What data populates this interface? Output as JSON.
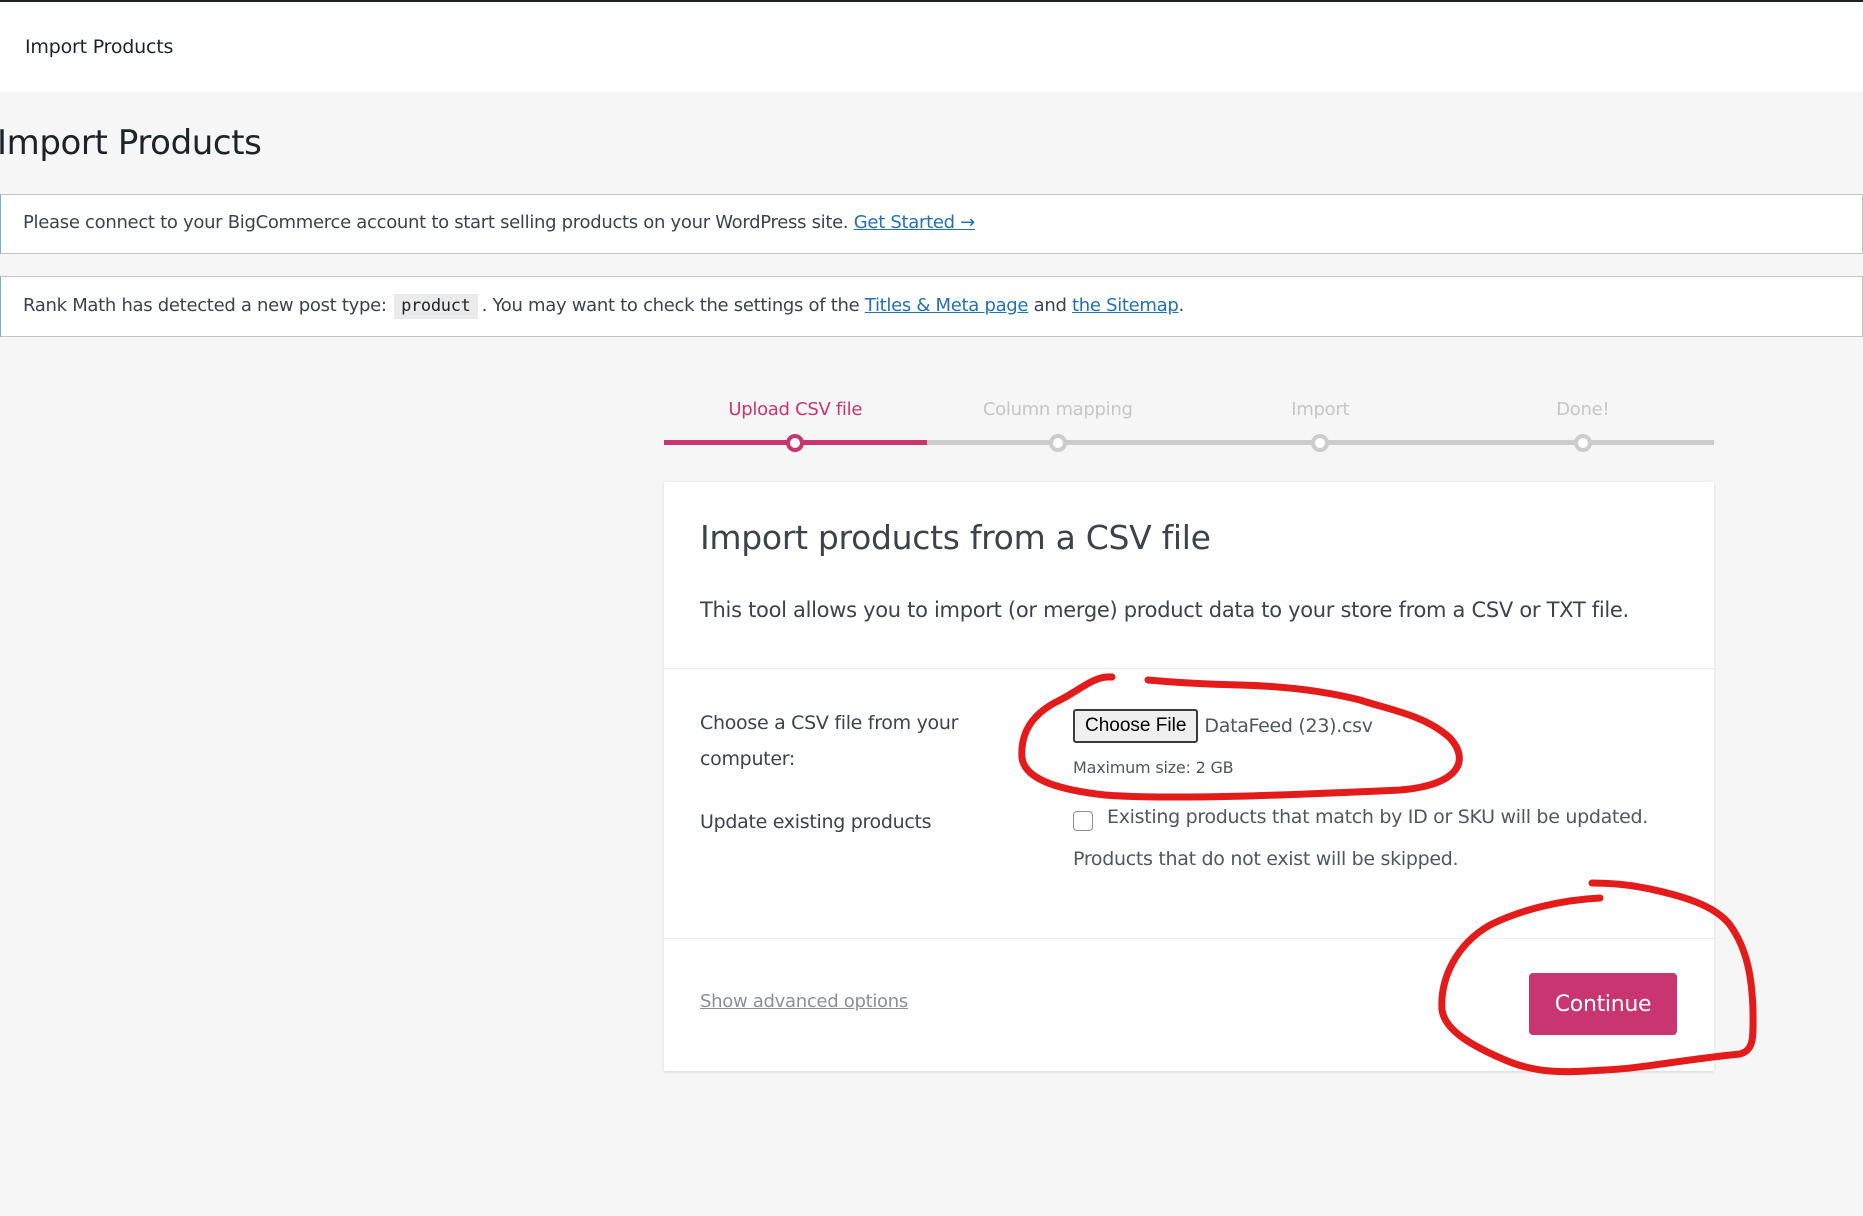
{
  "header": {
    "title": "Import Products"
  },
  "page": {
    "title": "Import Products"
  },
  "notices": [
    {
      "text": "Please connect to your BigCommerce account to start selling products on your WordPress site.",
      "link": "Get Started →"
    },
    {
      "text_before": "Rank Math has detected a new post type:",
      "code": "product",
      "text_middle": ". You may want to check the settings of the",
      "link1": "Titles & Meta page",
      "text_and": "and",
      "link2": "the Sitemap",
      "text_end": "."
    }
  ],
  "stepper": {
    "steps": [
      {
        "label": "Upload CSV file",
        "active": true
      },
      {
        "label": "Column mapping",
        "active": false
      },
      {
        "label": "Import",
        "active": false
      },
      {
        "label": "Done!",
        "active": false
      }
    ]
  },
  "card": {
    "title": "Import products from a CSV file",
    "description": "This tool allows you to import (or merge) product data to your store from a CSV or TXT file.",
    "file_row": {
      "label": "Choose a CSV file from your computer:",
      "button": "Choose File",
      "file_name": "DataFeed (23).csv",
      "max_size": "Maximum size: 2 GB"
    },
    "update_row": {
      "label": "Update existing products",
      "checked": false,
      "checkbox_text": "Existing products that match by ID or SKU will be updated.",
      "note": "Products that do not exist will be skipped."
    },
    "footer": {
      "advanced_link": "Show advanced options",
      "continue": "Continue"
    }
  },
  "colors": {
    "accent": "#c9356e",
    "link": "#2271b1",
    "annotation": "#e31b1b",
    "inactive_step": "#cccccc"
  }
}
